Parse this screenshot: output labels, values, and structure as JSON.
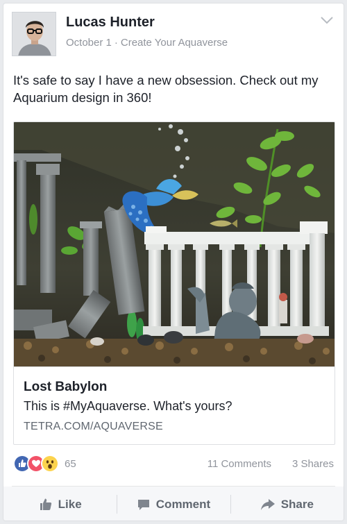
{
  "post": {
    "author": "Lucas Hunter",
    "date": "October 1",
    "separator": "·",
    "source": "Create Your Aquaverse",
    "text": "It's safe to say I have a new obsession. Check out my Aquarium design in 360!"
  },
  "link": {
    "title": "Lost Babylon",
    "description": "This is #MyAquaverse. What's yours?",
    "domain": "TETRA.COM/AQUAVERSE"
  },
  "stats": {
    "reaction_count": "65",
    "comments": "11 Comments",
    "shares": "3 Shares"
  },
  "actions": {
    "like": "Like",
    "comment": "Comment",
    "share": "Share"
  },
  "colors": {
    "like_blue": "#4267b2",
    "love_red": "#f25268",
    "wow_yellow": "#fcd34d",
    "action_gray": "#606770",
    "meta_gray": "#90949c"
  },
  "icons": [
    "chevron-down-icon",
    "like-reaction-icon",
    "love-reaction-icon",
    "wow-reaction-icon",
    "thumbs-up-icon",
    "comment-icon",
    "share-arrow-icon"
  ]
}
